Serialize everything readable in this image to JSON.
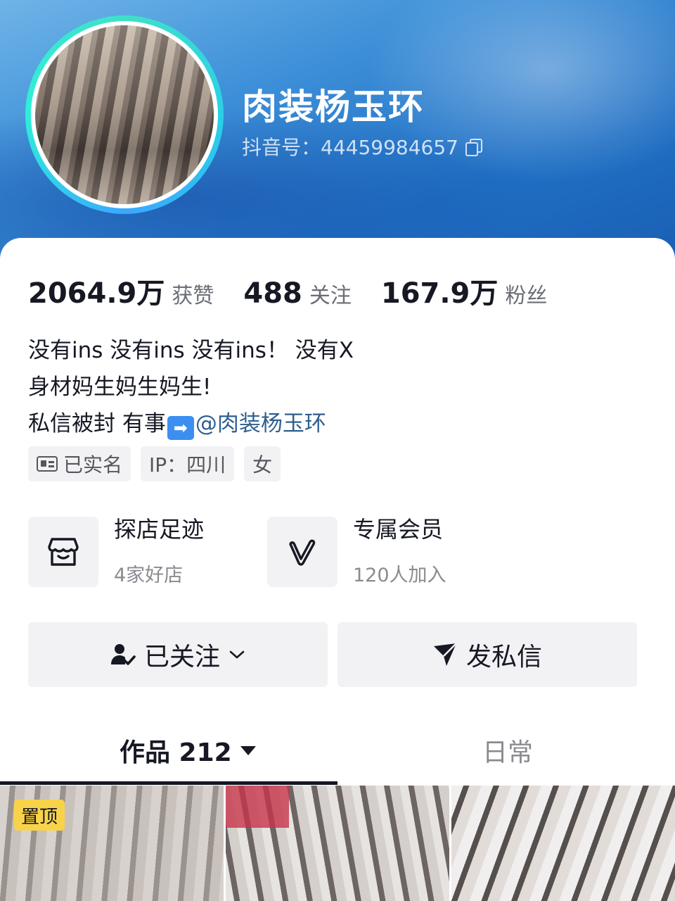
{
  "profile": {
    "name": "肉装杨玉环",
    "douyin_id": "抖音号：44459984657"
  },
  "stats": [
    {
      "value": "2064.9万",
      "label": "获赞"
    },
    {
      "value": "488",
      "label": "关注"
    },
    {
      "value": "167.9万",
      "label": "粉丝"
    }
  ],
  "bio": {
    "line1": "没有ins 没有ins 没有ins！ 没有X",
    "line2": "身材妈生妈生妈生!",
    "line3_prefix": "私信被封 有事",
    "line3_arrow": "➡",
    "line3_mention": "@肉装杨玉环"
  },
  "tags": {
    "verified": "已实名",
    "ip": "IP：四川",
    "gender": "女"
  },
  "features": [
    {
      "title": "探店足迹",
      "subtitle": "4家好店",
      "icon": "store-icon"
    },
    {
      "title": "专属会员",
      "subtitle": "120人加入",
      "icon": "v-member-icon"
    }
  ],
  "actions": {
    "follow_label": "已关注",
    "message_label": "发私信"
  },
  "tabs": {
    "works_label": "作品 212",
    "daily_label": "日常"
  },
  "posts": {
    "pinned_badge": "置顶"
  },
  "colors": {
    "header_blue": "#2a74c6",
    "text_primary": "#161823",
    "text_secondary": "#8a8b91",
    "mention": "#2e5f8f",
    "pin_badge": "#f8d34a",
    "avatar_ring": "#2ad0e6"
  }
}
